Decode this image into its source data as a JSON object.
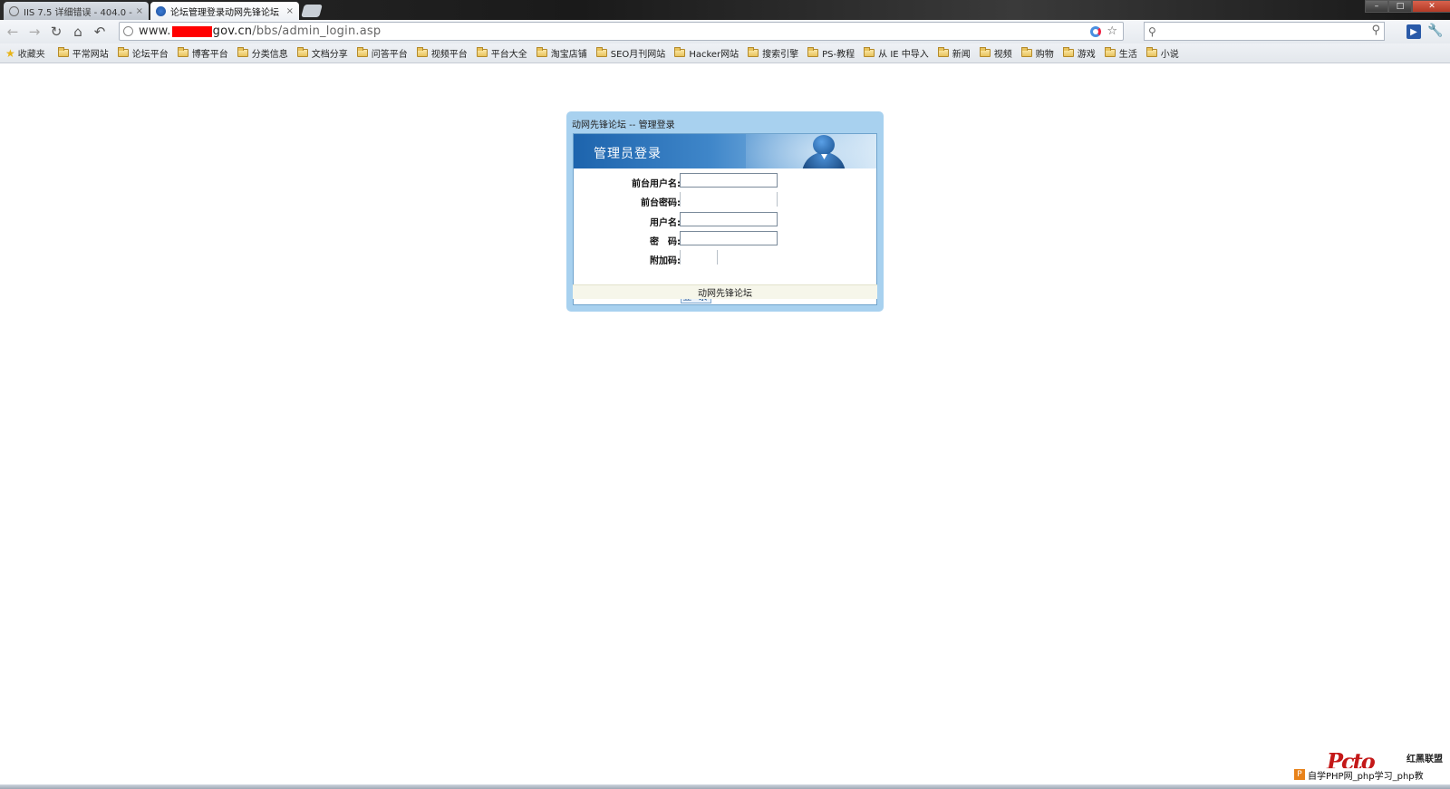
{
  "browser": {
    "tabs": [
      {
        "label": "IIS 7.5 详细错误 - 404.0 -",
        "active": false
      },
      {
        "label": "论坛管理登录动网先锋论坛",
        "active": true
      }
    ],
    "tab_close": "×",
    "window_controls": {
      "minimize": "–",
      "maximize": "□",
      "close": "✕"
    },
    "address": {
      "prefix": "www.",
      "host": "gov.cn",
      "path": "/bbs/admin_login.asp"
    },
    "icons": {
      "back": "back-arrow-icon",
      "forward": "forward-arrow-icon",
      "reload": "reload-icon",
      "home": "home-icon",
      "undo": "undo-icon"
    }
  },
  "bookmarks": {
    "favorites_label": "收藏夹",
    "items": [
      "平常网站",
      "论坛平台",
      "博客平台",
      "分类信息",
      "文档分享",
      "问答平台",
      "视频平台",
      "平台大全",
      "淘宝店铺",
      "SEO月刊网站",
      "Hacker网站",
      "搜索引擎",
      "PS-教程",
      "从 IE 中导入",
      "新闻",
      "视频",
      "购物",
      "游戏",
      "生活",
      "小说"
    ]
  },
  "login": {
    "panel_title": "动网先锋论坛 -- 管理登录",
    "banner_title": "管理员登录",
    "fields": {
      "front_username": "前台用户名:",
      "front_password": "前台密码:",
      "username": "用户名:",
      "password": "密　码:",
      "code": "附加码:"
    },
    "button": "登 录",
    "footer": "动网先锋论坛"
  },
  "watermark": {
    "logo": "Pcto",
    "brand": "红黑联盟",
    "text": "自学PHP网_php学习_php教"
  },
  "colors": {
    "panel_bg": "#a8d1ef",
    "banner": "#1d64ad",
    "redaction": "#ff0000"
  }
}
